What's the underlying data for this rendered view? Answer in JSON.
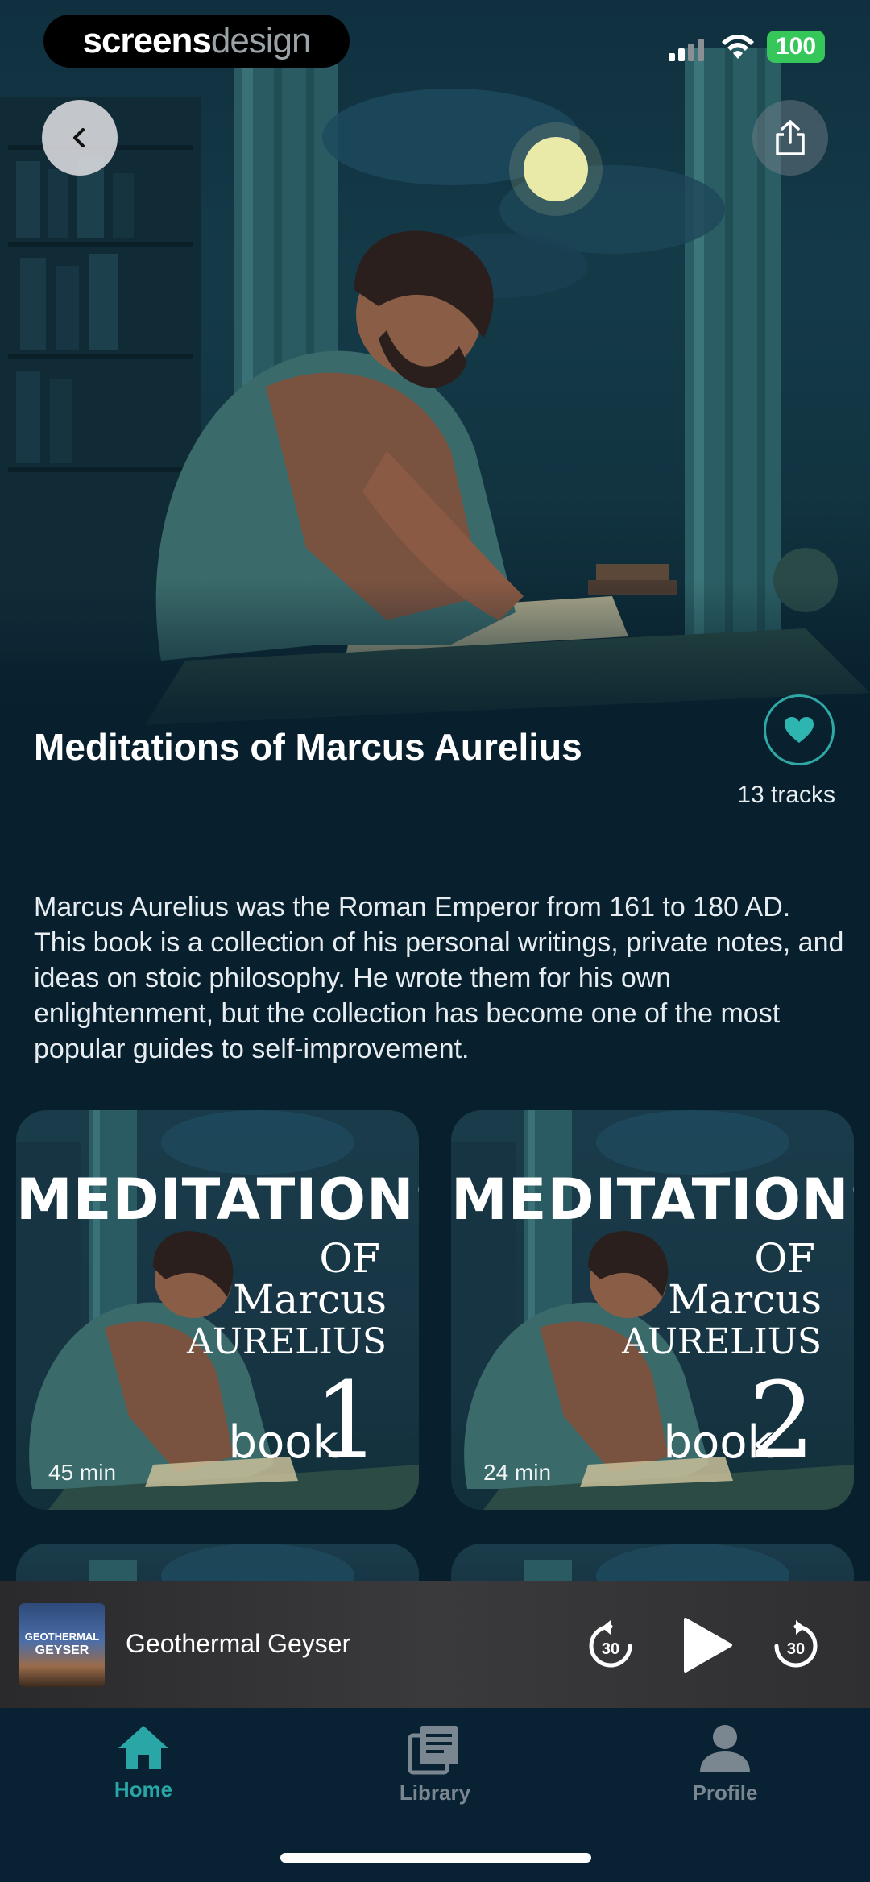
{
  "status_bar": {
    "brand_part1": "screens",
    "brand_part2": "design",
    "battery": "100"
  },
  "header": {
    "back_icon": "chevron-left-icon",
    "share_icon": "share-icon"
  },
  "album": {
    "title": "Meditations of Marcus Aurelius",
    "tracks": "13 tracks",
    "favorite_icon": "heart-icon",
    "description": "Marcus Aurelius was the Roman Emperor from 161 to 180 AD. This book is a collection of his personal writings, private notes, and ideas on stoic philosophy. He wrote them for his own enlightenment, but the collection has become one of the most popular guides to self-improvement."
  },
  "cards": [
    {
      "title": "MEDITATIONS",
      "of": "OF",
      "marcus": "Marcus",
      "aurelius": "AURELIUS",
      "book": "book",
      "number": "1",
      "duration": "45 min"
    },
    {
      "title": "MEDITATIONS",
      "of": "OF",
      "marcus": "Marcus",
      "aurelius": "AURELIUS",
      "book": "book",
      "number": "2",
      "duration": "24 min"
    }
  ],
  "mini_player": {
    "thumb_line1": "GEOTHERMAL",
    "thumb_line2": "GEYSER",
    "title": "Geothermal Geyser",
    "rewind_label": "30",
    "forward_label": "30"
  },
  "tabs": [
    {
      "label": "Home",
      "icon": "home-icon",
      "active": true
    },
    {
      "label": "Library",
      "icon": "library-icon",
      "active": false
    },
    {
      "label": "Profile",
      "icon": "profile-icon",
      "active": false
    }
  ],
  "colors": {
    "accent": "#2aa6a6",
    "background": "#08202e",
    "battery": "#35c759"
  }
}
